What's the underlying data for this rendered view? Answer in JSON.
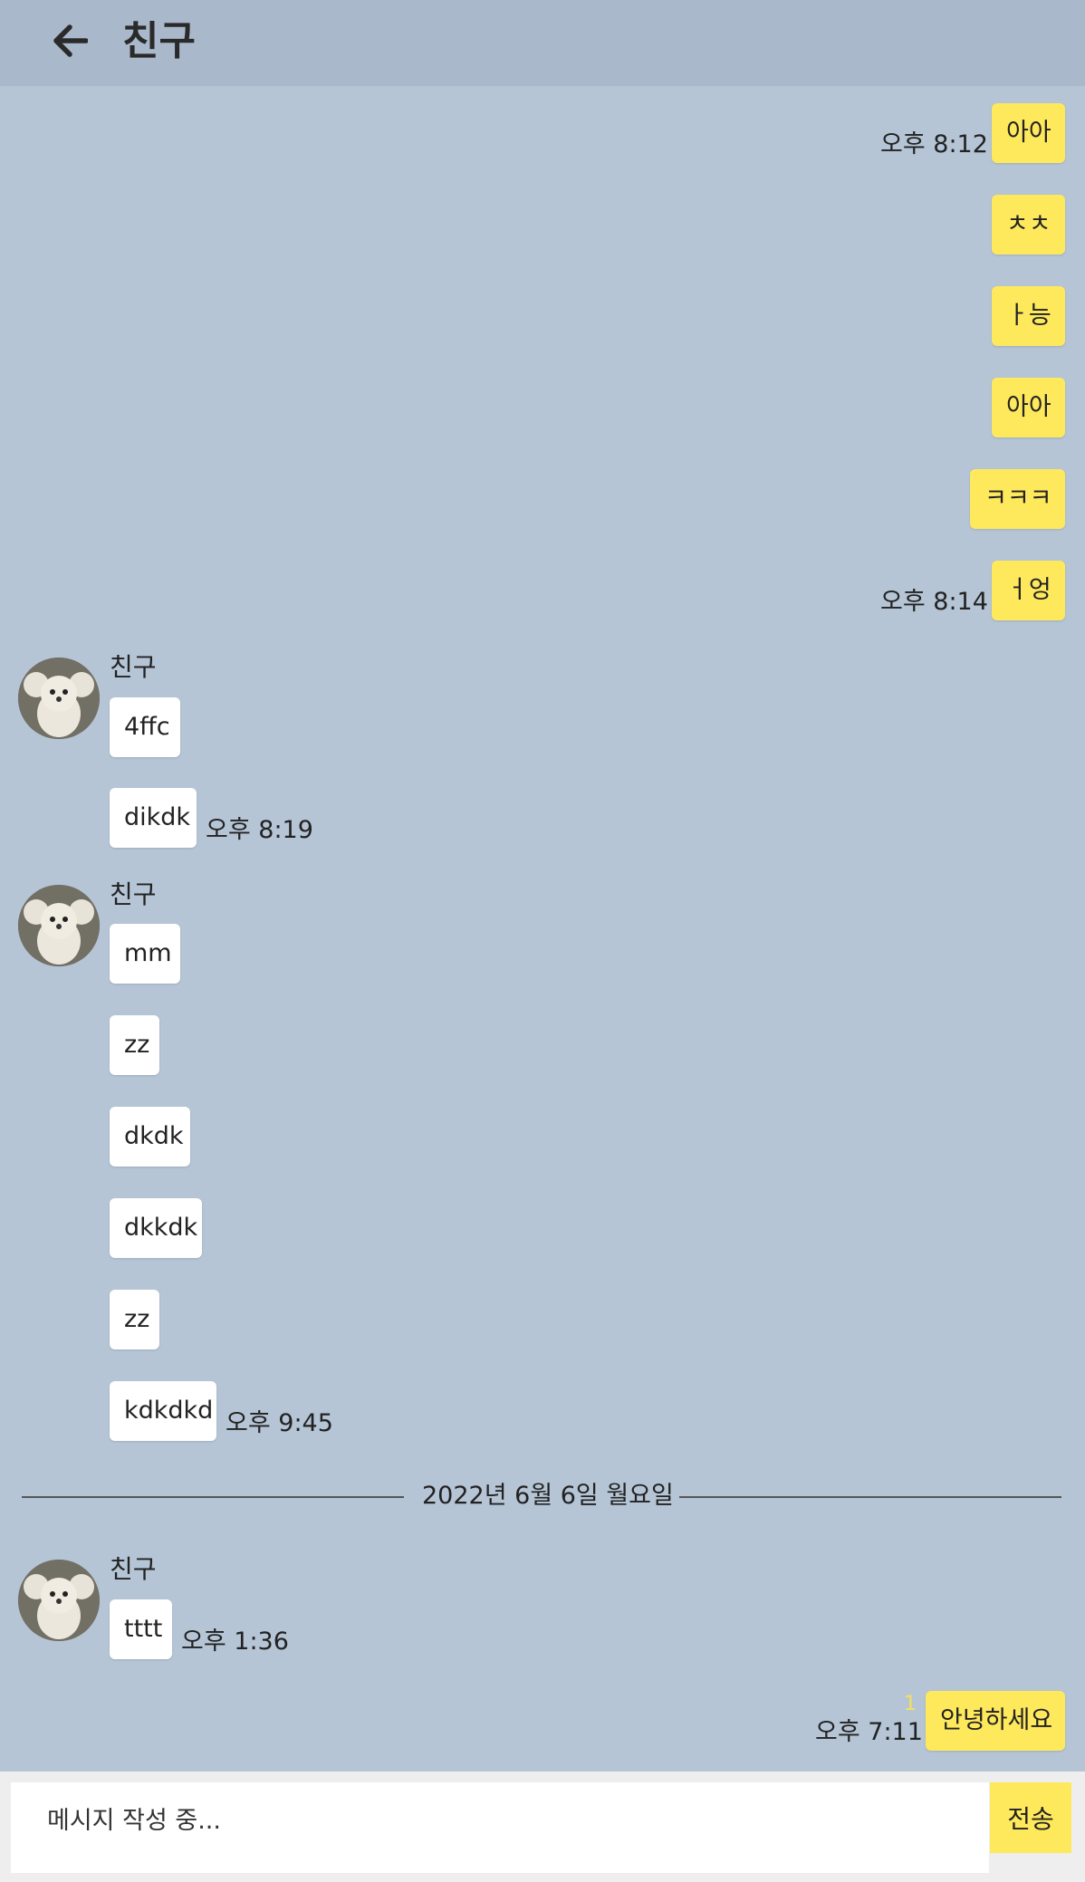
{
  "header": {
    "title": "친구",
    "back_icon": "arrow-left-icon"
  },
  "messages_top": [
    {
      "text": "아아",
      "time": "오후 8:12"
    },
    {
      "text": "ㅊㅊ"
    },
    {
      "text": "ㅏ능"
    },
    {
      "text": "아아"
    },
    {
      "text": "ㅋㅋㅋ"
    },
    {
      "text": "ㅓ엉",
      "time": "오후 8:14"
    }
  ],
  "group1": {
    "sender": "친구",
    "messages": [
      {
        "text": "4ffc"
      },
      {
        "text": "dikdk",
        "time": "오후 8:19"
      }
    ]
  },
  "group2": {
    "sender": "친구",
    "messages": [
      {
        "text": "mm"
      },
      {
        "text": "zz"
      },
      {
        "text": "dkdk"
      },
      {
        "text": "dkkdk"
      },
      {
        "text": "zz"
      },
      {
        "text": "kdkdkd",
        "time": "오후 9:45"
      }
    ]
  },
  "date_divider": "2022년 6월 6일 월요일",
  "group3": {
    "sender": "친구",
    "messages": [
      {
        "text": "tttt",
        "time": "오후 1:36"
      }
    ]
  },
  "my_last": {
    "text": "안녕하세요",
    "time": "오후 7:11",
    "unread": "1"
  },
  "input": {
    "placeholder": "메시지 작성 중...",
    "send_label": "전송"
  },
  "colors": {
    "background": "#b5c5d6",
    "header": "#a9b9cb",
    "my_bubble": "#fee95d",
    "their_bubble": "#ffffff"
  }
}
